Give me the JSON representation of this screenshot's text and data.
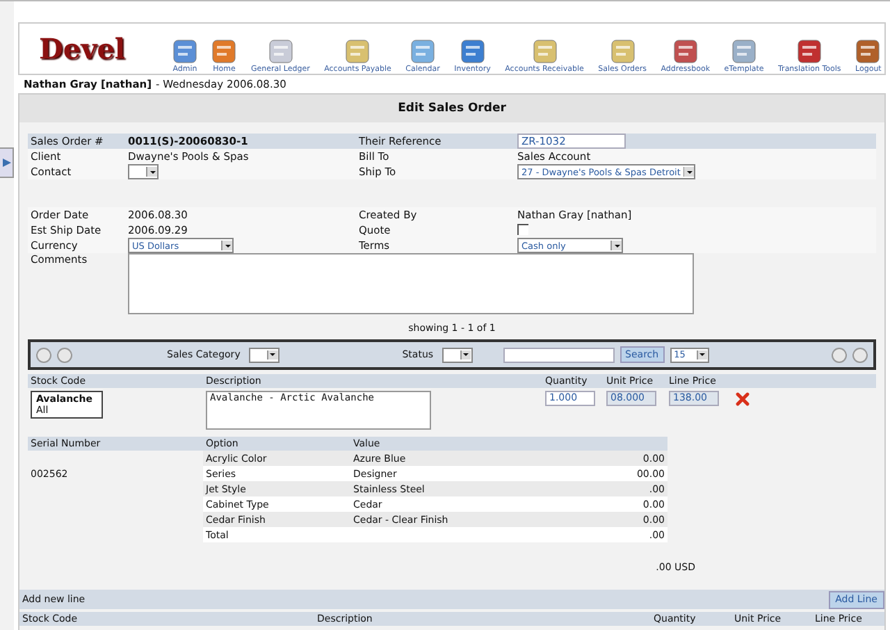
{
  "logo": "Devel",
  "toolbar": [
    {
      "label": "Admin"
    },
    {
      "label": "Home"
    },
    {
      "label": "General Ledger"
    },
    {
      "label": "Accounts Payable"
    },
    {
      "label": "Calendar"
    },
    {
      "label": "Inventory"
    },
    {
      "label": "Accounts Receivable"
    },
    {
      "label": "Sales Orders"
    },
    {
      "label": "Addressbook"
    },
    {
      "label": "eTemplate"
    },
    {
      "label": "Translation Tools"
    },
    {
      "label": "Logout"
    }
  ],
  "user_line": {
    "user": "Nathan Gray [nathan]",
    "date": "- Wednesday 2006.08.30"
  },
  "panel_title": "Edit Sales Order",
  "form_groups": [
    [
      {
        "highlight": true,
        "cells": [
          {
            "label": "Sales Order #",
            "kind": "bold",
            "value": "0011(S)-20060830-1"
          },
          {
            "label": "Their Reference",
            "kind": "input",
            "value": "ZR-1032"
          }
        ]
      },
      {
        "highlight": false,
        "cells": [
          {
            "label": "Client",
            "kind": "text",
            "value": "Dwayne's Pools & Spas"
          },
          {
            "label": "Bill To",
            "kind": "text",
            "value": "Sales Account"
          }
        ]
      },
      {
        "highlight": false,
        "cells": [
          {
            "label": "Contact",
            "kind": "select"
          },
          {
            "label": "Ship To",
            "kind": "select",
            "value": "27 - Dwayne's Pools & Spas Detroit"
          }
        ]
      }
    ],
    [
      {
        "highlight": false,
        "cells": [
          {
            "label": "Order Date",
            "kind": "text",
            "value": "2006.08.30"
          },
          {
            "label": "Created By",
            "kind": "text",
            "value": "Nathan Gray [nathan]"
          }
        ]
      },
      {
        "highlight": false,
        "cells": [
          {
            "label": "Est Ship Date",
            "kind": "text",
            "value": "2006.09.29"
          },
          {
            "label": "Quote",
            "kind": "checkbox",
            "checked": false
          }
        ]
      },
      {
        "highlight": false,
        "cells": [
          {
            "label": "Currency",
            "kind": "select",
            "value": "US Dollars"
          },
          {
            "label": "Terms",
            "kind": "select",
            "value": "Cash only"
          }
        ]
      }
    ]
  ],
  "comments": {
    "label": "Comments"
  },
  "showing": "showing 1 - 1 of 1",
  "filter": {
    "category_label": "Sales Category",
    "status_label": "Status",
    "search_button": "Search",
    "page_size": "15"
  },
  "lines": {
    "columns": [
      "Stock Code",
      "Description",
      "Quantity",
      "Unit Price",
      "Line Price"
    ],
    "item": {
      "stock_code": "Avalanche",
      "stock_group": "All",
      "description": "Avalanche - Arctic Avalanche",
      "quantity": "1.000",
      "unit_price": "08.000",
      "line_price": "138.00"
    }
  },
  "options": {
    "columns": [
      "Serial Number",
      "Option",
      "Value"
    ],
    "rows": [
      {
        "option": "Acrylic Color",
        "value": "Azure Blue",
        "amount": "0.00"
      },
      {
        "serial": "002562",
        "option": "Series",
        "value": "Designer",
        "amount": "00.00"
      },
      {
        "option": "Jet Style",
        "value": "Stainless Steel",
        "amount": ".00"
      },
      {
        "option": "Cabinet Type",
        "value": "Cedar",
        "amount": "0.00"
      },
      {
        "option": "Cedar Finish",
        "value": "Cedar - Clear Finish",
        "amount": "0.00"
      },
      {
        "option": "Total",
        "amount": ".00"
      }
    ]
  },
  "order_total": ".00 USD",
  "add_line": {
    "label": "Add new line",
    "button": "Add Line"
  },
  "bottom_columns": [
    "Stock Code",
    "Description",
    "Quantity",
    "Unit Price",
    "Line Price"
  ]
}
